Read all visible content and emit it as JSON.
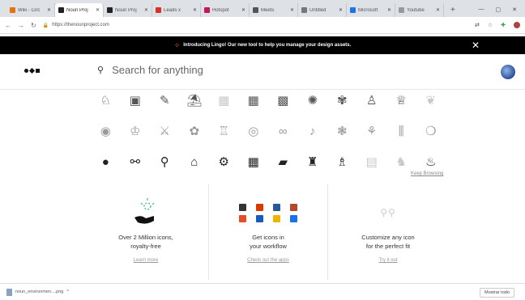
{
  "browser": {
    "tabs": [
      {
        "label": "Wiki - Circ",
        "color": "#e8710a",
        "active": false
      },
      {
        "label": "Noun Proj",
        "color": "#222222",
        "active": true
      },
      {
        "label": "Noun Proj",
        "color": "#222222",
        "active": false
      },
      {
        "label": "Leads x",
        "color": "#d93025",
        "active": false
      },
      {
        "label": "Hotspot",
        "color": "#c2185b",
        "active": false
      },
      {
        "label": "Meets",
        "color": "#555555",
        "active": false
      },
      {
        "label": "Untitled",
        "color": "#777777",
        "active": false
      },
      {
        "label": "Microsoft",
        "color": "#1a73e8",
        "active": false
      },
      {
        "label": "Youtube",
        "color": "#999999",
        "active": false
      }
    ],
    "new_tab": "+",
    "url": "https://thenounproject.com"
  },
  "announcement": {
    "text": "Introducing Lingo! Our new tool to help you manage your design assets.",
    "close": "✕"
  },
  "header": {
    "search_placeholder": "Search for anything"
  },
  "icon_grid": {
    "rows": [
      [
        "♘",
        "▣",
        "✎",
        "⛱",
        "▦",
        "▦",
        "▩",
        "✺",
        "✾",
        "♙",
        "♕",
        "❦"
      ],
      [
        "◉",
        "♔",
        "⚔",
        "✿",
        "♖",
        "◎",
        "∞",
        "♪",
        "❃",
        "⚘",
        "⫼",
        "❍"
      ],
      [
        "●",
        "⚯",
        "⚲",
        "⌂",
        "⚙",
        "▦",
        "▰",
        "♜",
        "♗",
        "▤",
        "♞",
        "♨"
      ]
    ],
    "keep_browsing": "Keep Browsing"
  },
  "features": [
    {
      "title_line1": "Over 2 Million icons,",
      "title_line2": "royalty-free",
      "link": "Learn more"
    },
    {
      "title_line1": "Get icons in",
      "title_line2": "your workflow",
      "link": "Check out the apps"
    },
    {
      "title_line1": "Customize any icon",
      "title_line2": "for the perfect fit",
      "link": "Try it out"
    }
  ],
  "apps_colors": [
    "#333333",
    "#d83b01",
    "#2b579a",
    "#b7472a",
    "#e34f26",
    "#185abd",
    "#f0b400",
    "#1a73e8"
  ],
  "download": {
    "file": "noun_environmen....png",
    "show_all": "Mostrar todo"
  }
}
